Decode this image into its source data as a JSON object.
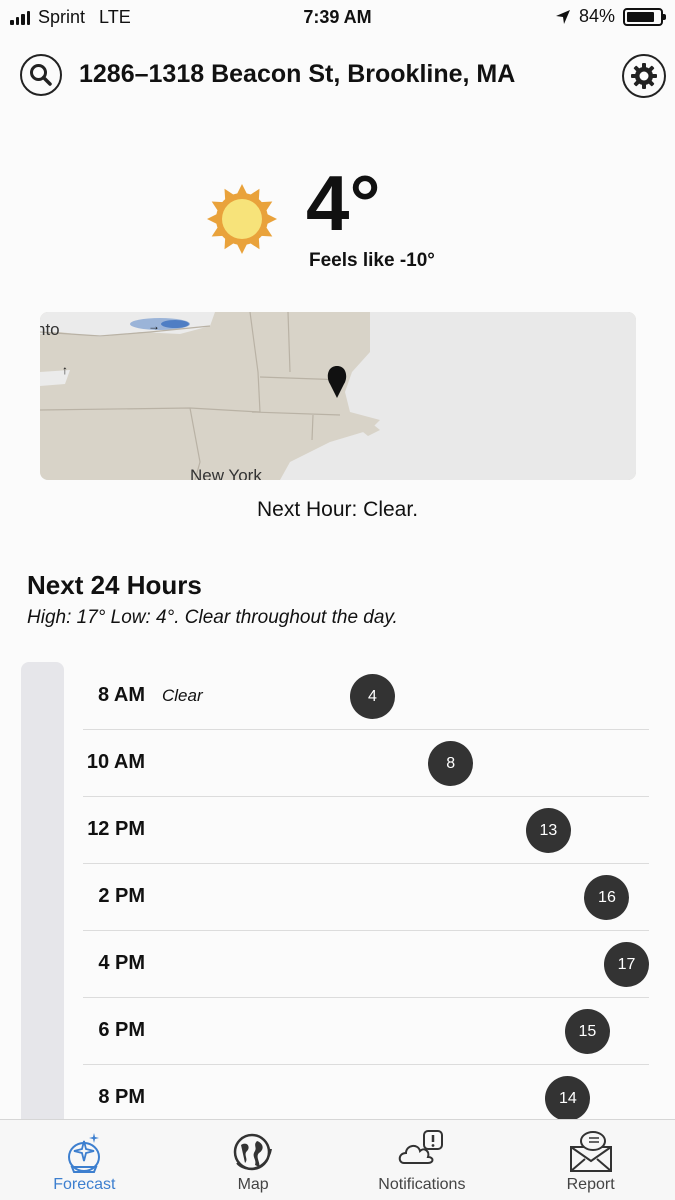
{
  "status_bar": {
    "carrier": "Sprint",
    "network": "LTE",
    "time": "7:39 AM",
    "battery_percent": "84%",
    "battery_level": 0.84
  },
  "header": {
    "location": "1286–1318 Beacon St, Brookline, MA",
    "search_icon": "search-icon",
    "settings_icon": "gear-icon"
  },
  "current": {
    "temperature": "4°",
    "feels_like": "Feels like -10°",
    "icon": "sun-icon"
  },
  "map": {
    "labels": {
      "toronto": "nto",
      "city": "New York"
    }
  },
  "next_hour": "Next Hour: Clear.",
  "next_24": {
    "title": "Next 24 Hours",
    "summary": "High: 17° Low: 4°. Clear throughout the day.",
    "hours": [
      {
        "time": "8 AM",
        "condition": "Clear",
        "temp": "4"
      },
      {
        "time": "10 AM",
        "condition": "",
        "temp": "8"
      },
      {
        "time": "12 PM",
        "condition": "",
        "temp": "13"
      },
      {
        "time": "2 PM",
        "condition": "",
        "temp": "16"
      },
      {
        "time": "4 PM",
        "condition": "",
        "temp": "17"
      },
      {
        "time": "6 PM",
        "condition": "",
        "temp": "15"
      },
      {
        "time": "8 PM",
        "condition": "",
        "temp": "14"
      }
    ]
  },
  "tabs": [
    {
      "label": "Forecast",
      "icon": "forecast-icon",
      "active": true
    },
    {
      "label": "Map",
      "icon": "globe-icon",
      "active": false
    },
    {
      "label": "Notifications",
      "icon": "cloud-alert-icon",
      "active": false
    },
    {
      "label": "Report",
      "icon": "envelope-icon",
      "active": false
    }
  ],
  "colors": {
    "accent": "#3d7fcf",
    "temp_dot": "#333333",
    "sun": "#f2c04c"
  }
}
